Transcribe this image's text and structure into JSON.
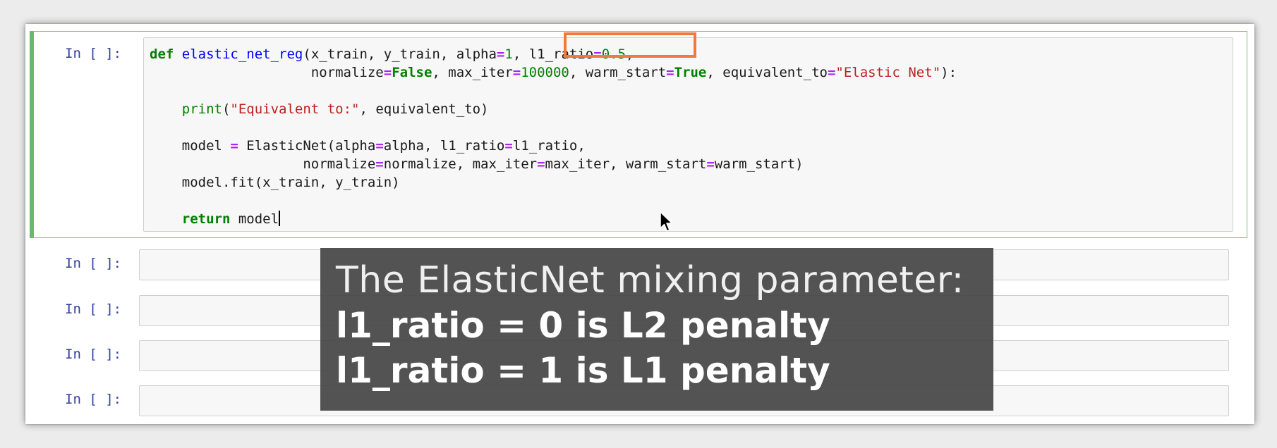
{
  "cells": {
    "prompt_label": "In [ ]:",
    "main_code": {
      "line1": {
        "def": "def",
        "fname": "elastic_net_reg",
        "args1": "(x_train, y_train, alpha",
        "eq": "=",
        "alpha_val": "1",
        "comma_sp": ", ",
        "l1_name": "l1_ratio",
        "l1_val": "0.5",
        "trail": ","
      },
      "line2": {
        "indent": "                    normalize",
        "false_kw": "False",
        "mid1": ", max_iter",
        "iter_val": "100000",
        "mid2": ", warm_start",
        "true_kw": "True",
        "mid3": ", equivalent_to",
        "str_val": "\"Elastic Net\"",
        "end": "):"
      },
      "line4": {
        "indent": "    ",
        "print_kw": "print",
        "open": "(",
        "str_val": "\"Equivalent to:\"",
        "rest": ", equivalent_to)"
      },
      "line6": {
        "text1": "    model ",
        "eq": "=",
        "text2": " ElasticNet(alpha",
        "text3": "alpha, l1_ratio",
        "text4": "l1_ratio,"
      },
      "line7": {
        "text1": "                   normalize",
        "text2": "normalize, max_iter",
        "text3": "max_iter, warm_start",
        "text4": "warm_start)"
      },
      "line8": "    model.fit(x_train, y_train)",
      "line10": {
        "indent": "    ",
        "return_kw": "return",
        "rest": " model"
      }
    }
  },
  "overlay": {
    "line1": "The ElasticNet mixing parameter:",
    "line2": "l1_ratio = 0 is L2 penalty",
    "line3": "l1_ratio = 1 is L1 penalty"
  },
  "colors": {
    "selected_border": "#66bb6a",
    "highlight_box": "#ee7a3c",
    "prompt": "#303f9f",
    "keyword": "#008000",
    "function_name": "#0000ff",
    "operator": "#aa22ff",
    "string": "#ba2121"
  }
}
